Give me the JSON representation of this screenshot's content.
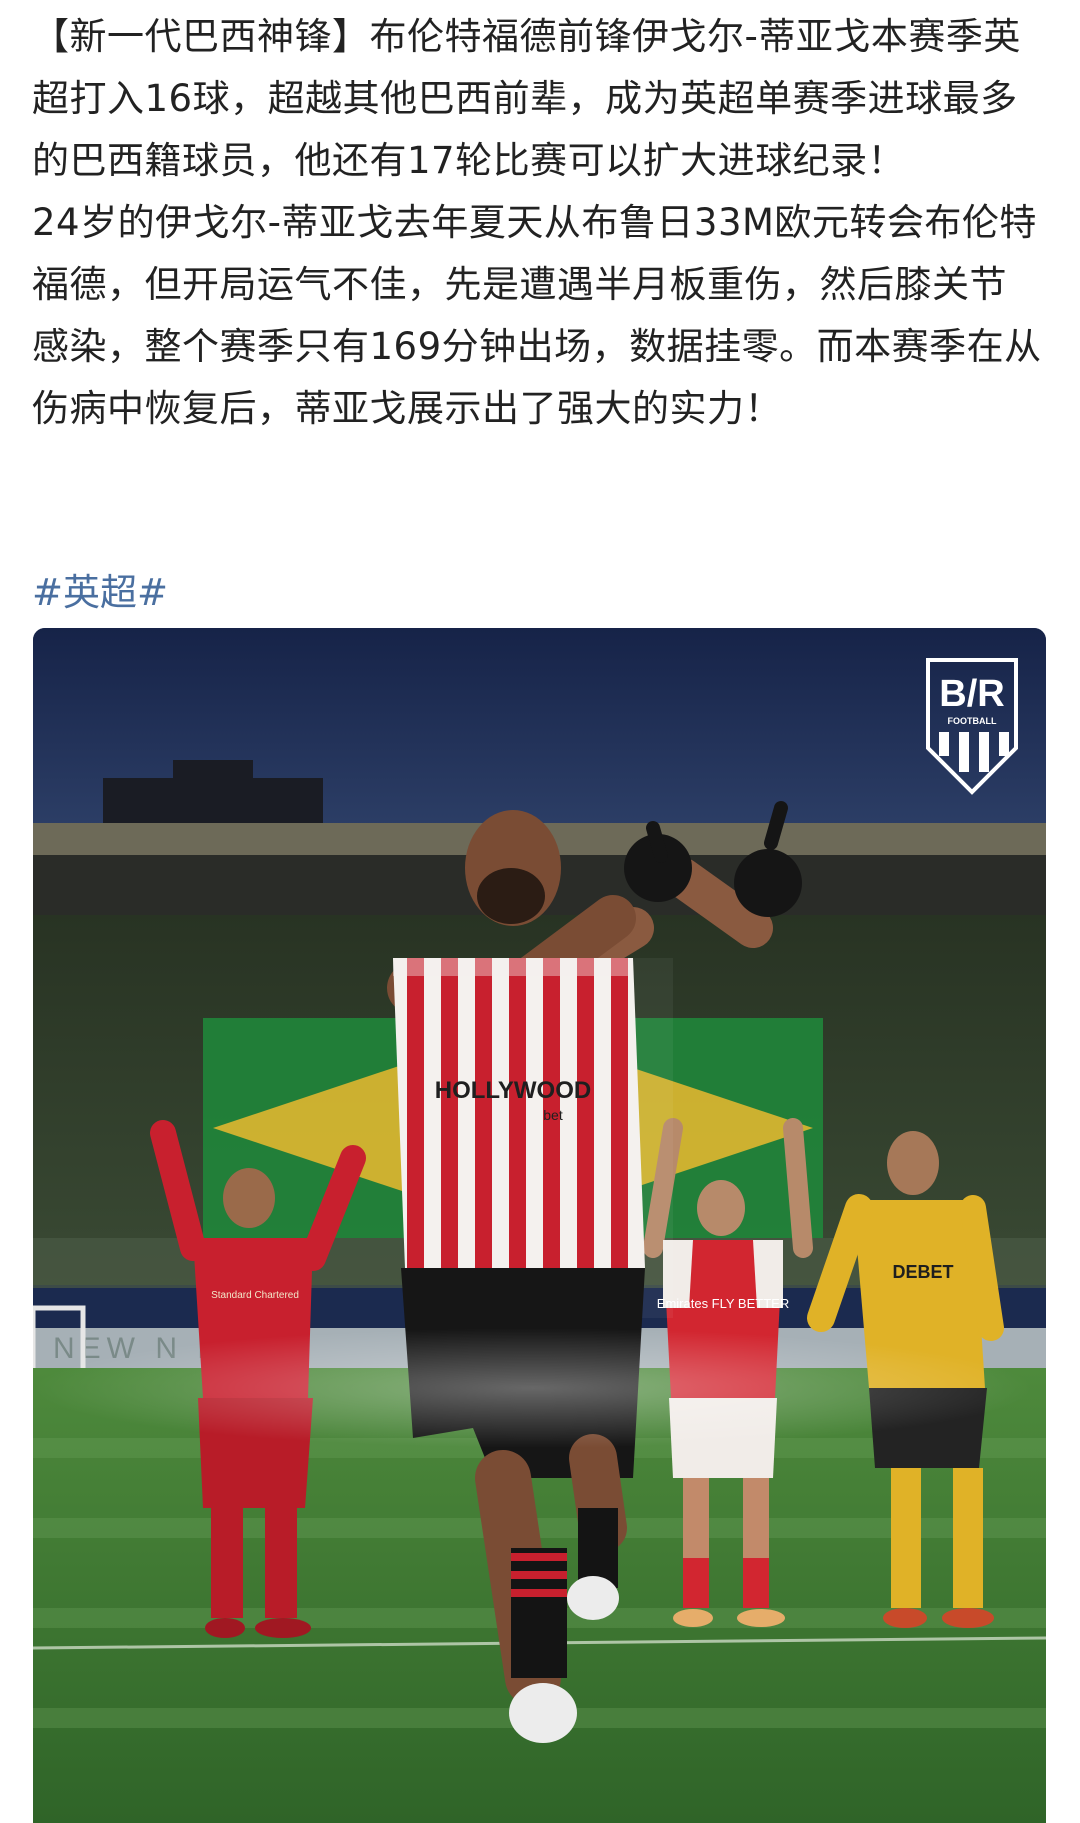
{
  "post": {
    "paragraph1": "【新一代巴西神锋】布伦特福德前锋伊戈尔-蒂亚戈本赛季英超打入16球，超越其他巴西前辈，成为英超单赛季进球最多的巴西籍球员，他还有17轮比赛可以扩大进球纪录！",
    "paragraph2": "24岁的伊戈尔-蒂亚戈去年夏天从布鲁日33M欧元转会布伦特福德，但开局运气不佳，先是遭遇半月板重伤，然后膝关节感染，整个赛季只有169分钟出场，数据挂零。而本赛季在从伤病中恢复后，蒂亚戈展示出了强大的实力！",
    "hashtag": "#英超#"
  },
  "image": {
    "logo_text": "B/R",
    "logo_subtext": "FOOTBALL",
    "sponsor_text": "HOLLYWOOD",
    "sponsor_sub": "bet",
    "arsenal_sponsor": "Emirates FLY BETTER",
    "liverpool_sponsor": "Standard Chartered",
    "wolves_sponsor": "DEBET",
    "board_text": "NEW N  ERO"
  },
  "colors": {
    "text": "#222222",
    "hashtag": "#4a6fa0",
    "sky": "#1b2a4f",
    "pitch": "#3f7a32",
    "brentford_red": "#c8202e",
    "wolves_gold": "#e0b227"
  }
}
